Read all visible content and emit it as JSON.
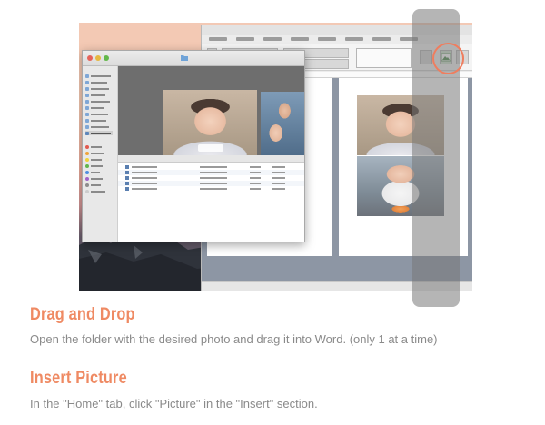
{
  "steps": [
    {
      "heading": "Drag and Drop",
      "description": "Open the folder with the desired photo and drag it into Word. (only 1 at a time)"
    },
    {
      "heading": "Insert Picture",
      "description": "In the \"Home\" tab, click \"Picture\" in the \"Insert\" section."
    }
  ],
  "colors": {
    "accent": "#ef8a63",
    "body_text": "#8a8a8a",
    "highlight_overlay": "#787878",
    "circle": "#ef7d5e"
  },
  "icons": [
    "folder-icon",
    "document-icon",
    "picture-icon"
  ]
}
